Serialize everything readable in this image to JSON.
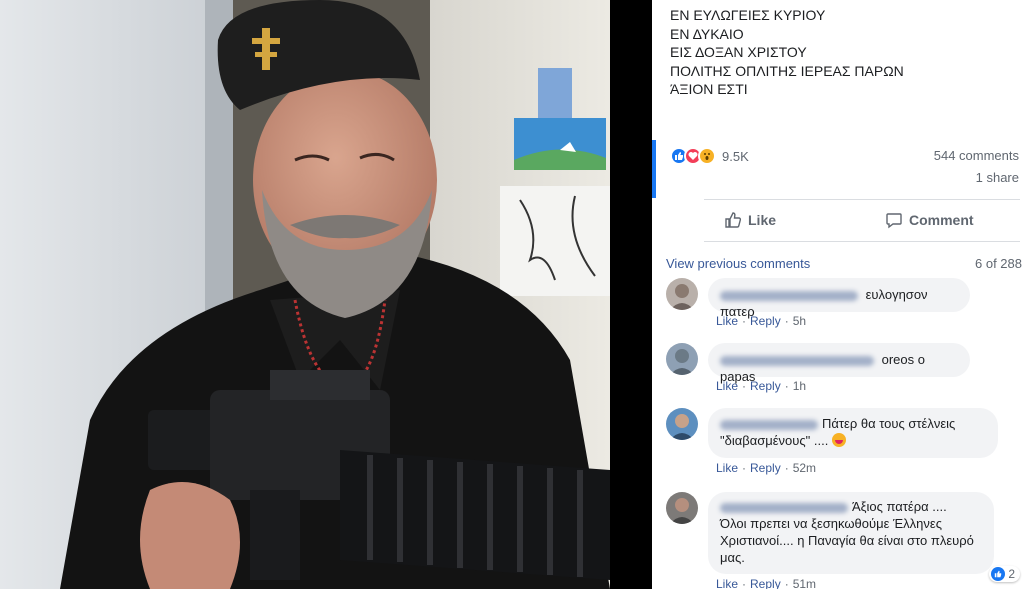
{
  "photo": {
    "description_icons": [
      "cross-emblem-icon",
      "rifle-icon",
      "wall-poster-icon"
    ]
  },
  "post": {
    "caption_lines": [
      "ΕΝ ΕΥΛΩΓΕΙΕΣ ΚΥΡΙΟΥ",
      "ΕΝ ΔΥΚΑΙΟ",
      "ΕΙΣ ΔΟΞΑΝ ΧΡΙΣΤΟΥ",
      "ΠΟΛΙΤΗΣ ΟΠΛΙΤΗΣ ΙΕΡΕΑΣ ΠΑΡΩΝ",
      "ΆΞΙΟΝ ΕΣΤΙ"
    ],
    "reactions": {
      "icons": [
        "like-reaction-icon",
        "love-reaction-icon",
        "wow-reaction-icon"
      ],
      "count": "9.5K"
    },
    "comments_count": "544 comments",
    "shares_count": "1 share"
  },
  "actions": {
    "like_label": "Like",
    "comment_label": "Comment"
  },
  "comments_header": {
    "view_previous": "View previous comments",
    "pager": "6 of 288"
  },
  "comments": [
    {
      "text": "ευλογησον πατερ",
      "like": "Like",
      "reply": "Reply",
      "time": "5h"
    },
    {
      "text": "oreos o papas",
      "like": "Like",
      "reply": "Reply",
      "time": "1h"
    },
    {
      "text_line1": "Πάτερ θα τους στέλνεις",
      "text_line2": "\"διαβασμένους\" ....",
      "like": "Like",
      "reply": "Reply",
      "time": "52m"
    },
    {
      "text_line1": "Άξιος πατέρα ....",
      "text_line2": "Όλοι πρεπει να ξεσηκωθούμε Έλληνες",
      "text_line3": "Χριστιανοί.... η Παναγία θα είναι στο πλευρό",
      "text_line4": "μας.",
      "like": "Like",
      "reply": "Reply",
      "time": "51m",
      "reaction_count": "2"
    }
  ],
  "colors": {
    "accent": "#1877f2",
    "link": "#385898",
    "bubble": "#f2f3f5",
    "muted": "#606770"
  }
}
